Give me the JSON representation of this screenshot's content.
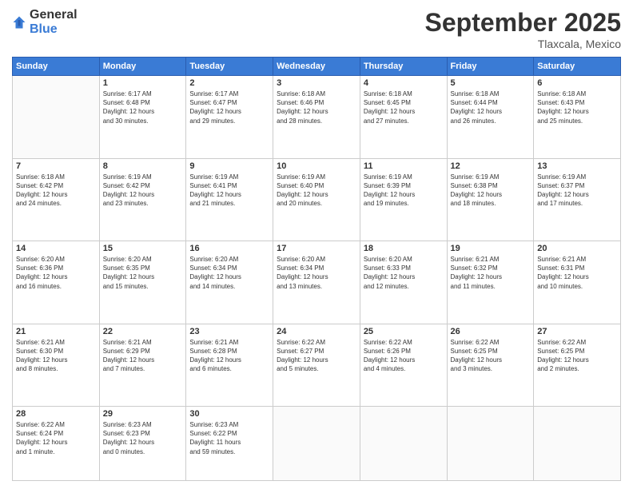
{
  "logo": {
    "general": "General",
    "blue": "Blue"
  },
  "header": {
    "month": "September 2025",
    "location": "Tlaxcala, Mexico"
  },
  "weekdays": [
    "Sunday",
    "Monday",
    "Tuesday",
    "Wednesday",
    "Thursday",
    "Friday",
    "Saturday"
  ],
  "weeks": [
    [
      {
        "day": "",
        "info": ""
      },
      {
        "day": "1",
        "info": "Sunrise: 6:17 AM\nSunset: 6:48 PM\nDaylight: 12 hours\nand 30 minutes."
      },
      {
        "day": "2",
        "info": "Sunrise: 6:17 AM\nSunset: 6:47 PM\nDaylight: 12 hours\nand 29 minutes."
      },
      {
        "day": "3",
        "info": "Sunrise: 6:18 AM\nSunset: 6:46 PM\nDaylight: 12 hours\nand 28 minutes."
      },
      {
        "day": "4",
        "info": "Sunrise: 6:18 AM\nSunset: 6:45 PM\nDaylight: 12 hours\nand 27 minutes."
      },
      {
        "day": "5",
        "info": "Sunrise: 6:18 AM\nSunset: 6:44 PM\nDaylight: 12 hours\nand 26 minutes."
      },
      {
        "day": "6",
        "info": "Sunrise: 6:18 AM\nSunset: 6:43 PM\nDaylight: 12 hours\nand 25 minutes."
      }
    ],
    [
      {
        "day": "7",
        "info": "Sunrise: 6:18 AM\nSunset: 6:42 PM\nDaylight: 12 hours\nand 24 minutes."
      },
      {
        "day": "8",
        "info": "Sunrise: 6:19 AM\nSunset: 6:42 PM\nDaylight: 12 hours\nand 23 minutes."
      },
      {
        "day": "9",
        "info": "Sunrise: 6:19 AM\nSunset: 6:41 PM\nDaylight: 12 hours\nand 21 minutes."
      },
      {
        "day": "10",
        "info": "Sunrise: 6:19 AM\nSunset: 6:40 PM\nDaylight: 12 hours\nand 20 minutes."
      },
      {
        "day": "11",
        "info": "Sunrise: 6:19 AM\nSunset: 6:39 PM\nDaylight: 12 hours\nand 19 minutes."
      },
      {
        "day": "12",
        "info": "Sunrise: 6:19 AM\nSunset: 6:38 PM\nDaylight: 12 hours\nand 18 minutes."
      },
      {
        "day": "13",
        "info": "Sunrise: 6:19 AM\nSunset: 6:37 PM\nDaylight: 12 hours\nand 17 minutes."
      }
    ],
    [
      {
        "day": "14",
        "info": "Sunrise: 6:20 AM\nSunset: 6:36 PM\nDaylight: 12 hours\nand 16 minutes."
      },
      {
        "day": "15",
        "info": "Sunrise: 6:20 AM\nSunset: 6:35 PM\nDaylight: 12 hours\nand 15 minutes."
      },
      {
        "day": "16",
        "info": "Sunrise: 6:20 AM\nSunset: 6:34 PM\nDaylight: 12 hours\nand 14 minutes."
      },
      {
        "day": "17",
        "info": "Sunrise: 6:20 AM\nSunset: 6:34 PM\nDaylight: 12 hours\nand 13 minutes."
      },
      {
        "day": "18",
        "info": "Sunrise: 6:20 AM\nSunset: 6:33 PM\nDaylight: 12 hours\nand 12 minutes."
      },
      {
        "day": "19",
        "info": "Sunrise: 6:21 AM\nSunset: 6:32 PM\nDaylight: 12 hours\nand 11 minutes."
      },
      {
        "day": "20",
        "info": "Sunrise: 6:21 AM\nSunset: 6:31 PM\nDaylight: 12 hours\nand 10 minutes."
      }
    ],
    [
      {
        "day": "21",
        "info": "Sunrise: 6:21 AM\nSunset: 6:30 PM\nDaylight: 12 hours\nand 8 minutes."
      },
      {
        "day": "22",
        "info": "Sunrise: 6:21 AM\nSunset: 6:29 PM\nDaylight: 12 hours\nand 7 minutes."
      },
      {
        "day": "23",
        "info": "Sunrise: 6:21 AM\nSunset: 6:28 PM\nDaylight: 12 hours\nand 6 minutes."
      },
      {
        "day": "24",
        "info": "Sunrise: 6:22 AM\nSunset: 6:27 PM\nDaylight: 12 hours\nand 5 minutes."
      },
      {
        "day": "25",
        "info": "Sunrise: 6:22 AM\nSunset: 6:26 PM\nDaylight: 12 hours\nand 4 minutes."
      },
      {
        "day": "26",
        "info": "Sunrise: 6:22 AM\nSunset: 6:25 PM\nDaylight: 12 hours\nand 3 minutes."
      },
      {
        "day": "27",
        "info": "Sunrise: 6:22 AM\nSunset: 6:25 PM\nDaylight: 12 hours\nand 2 minutes."
      }
    ],
    [
      {
        "day": "28",
        "info": "Sunrise: 6:22 AM\nSunset: 6:24 PM\nDaylight: 12 hours\nand 1 minute."
      },
      {
        "day": "29",
        "info": "Sunrise: 6:23 AM\nSunset: 6:23 PM\nDaylight: 12 hours\nand 0 minutes."
      },
      {
        "day": "30",
        "info": "Sunrise: 6:23 AM\nSunset: 6:22 PM\nDaylight: 11 hours\nand 59 minutes."
      },
      {
        "day": "",
        "info": ""
      },
      {
        "day": "",
        "info": ""
      },
      {
        "day": "",
        "info": ""
      },
      {
        "day": "",
        "info": ""
      }
    ]
  ]
}
